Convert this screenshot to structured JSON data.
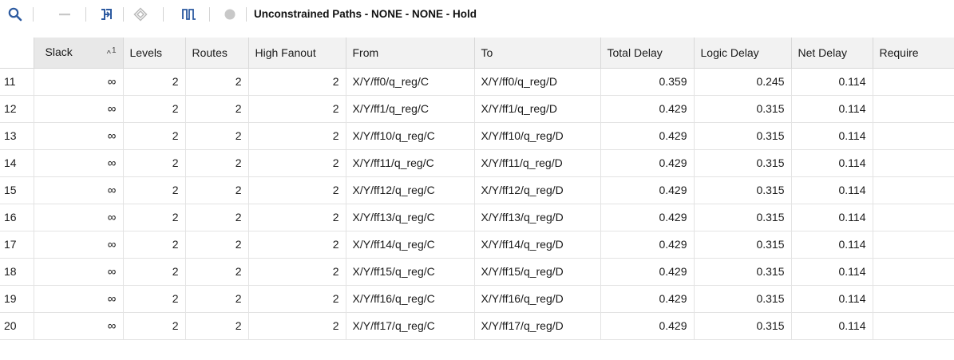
{
  "toolbar": {
    "title": "Unconstrained Paths - NONE - NONE - Hold",
    "buttons": [
      {
        "name": "search-icon"
      },
      {
        "name": "collapse-icon"
      },
      {
        "name": "schematic-icon"
      },
      {
        "name": "highlight-icon"
      },
      {
        "name": "waveform-icon"
      },
      {
        "name": "circle-icon"
      }
    ],
    "colors": {
      "accent": "#2c5aa0",
      "disabled": "#c8c8c8"
    }
  },
  "table": {
    "sort": {
      "column": "Slack",
      "order": "^",
      "rank": "1"
    },
    "columns": [
      "Slack",
      "Levels",
      "Routes",
      "High Fanout",
      "From",
      "To",
      "Total Delay",
      "Logic Delay",
      "Net Delay",
      "Require"
    ],
    "rows": [
      {
        "id": "11",
        "slack": "∞",
        "levels": "2",
        "routes": "2",
        "fanout": "2",
        "from": "X/Y/ff0/q_reg/C",
        "to": "X/Y/ff0/q_reg/D",
        "total": "0.359",
        "logic": "0.245",
        "net": "0.114"
      },
      {
        "id": "12",
        "slack": "∞",
        "levels": "2",
        "routes": "2",
        "fanout": "2",
        "from": "X/Y/ff1/q_reg/C",
        "to": "X/Y/ff1/q_reg/D",
        "total": "0.429",
        "logic": "0.315",
        "net": "0.114"
      },
      {
        "id": "13",
        "slack": "∞",
        "levels": "2",
        "routes": "2",
        "fanout": "2",
        "from": "X/Y/ff10/q_reg/C",
        "to": "X/Y/ff10/q_reg/D",
        "total": "0.429",
        "logic": "0.315",
        "net": "0.114"
      },
      {
        "id": "14",
        "slack": "∞",
        "levels": "2",
        "routes": "2",
        "fanout": "2",
        "from": "X/Y/ff11/q_reg/C",
        "to": "X/Y/ff11/q_reg/D",
        "total": "0.429",
        "logic": "0.315",
        "net": "0.114"
      },
      {
        "id": "15",
        "slack": "∞",
        "levels": "2",
        "routes": "2",
        "fanout": "2",
        "from": "X/Y/ff12/q_reg/C",
        "to": "X/Y/ff12/q_reg/D",
        "total": "0.429",
        "logic": "0.315",
        "net": "0.114"
      },
      {
        "id": "16",
        "slack": "∞",
        "levels": "2",
        "routes": "2",
        "fanout": "2",
        "from": "X/Y/ff13/q_reg/C",
        "to": "X/Y/ff13/q_reg/D",
        "total": "0.429",
        "logic": "0.315",
        "net": "0.114"
      },
      {
        "id": "17",
        "slack": "∞",
        "levels": "2",
        "routes": "2",
        "fanout": "2",
        "from": "X/Y/ff14/q_reg/C",
        "to": "X/Y/ff14/q_reg/D",
        "total": "0.429",
        "logic": "0.315",
        "net": "0.114"
      },
      {
        "id": "18",
        "slack": "∞",
        "levels": "2",
        "routes": "2",
        "fanout": "2",
        "from": "X/Y/ff15/q_reg/C",
        "to": "X/Y/ff15/q_reg/D",
        "total": "0.429",
        "logic": "0.315",
        "net": "0.114"
      },
      {
        "id": "19",
        "slack": "∞",
        "levels": "2",
        "routes": "2",
        "fanout": "2",
        "from": "X/Y/ff16/q_reg/C",
        "to": "X/Y/ff16/q_reg/D",
        "total": "0.429",
        "logic": "0.315",
        "net": "0.114"
      },
      {
        "id": "20",
        "slack": "∞",
        "levels": "2",
        "routes": "2",
        "fanout": "2",
        "from": "X/Y/ff17/q_reg/C",
        "to": "X/Y/ff17/q_reg/D",
        "total": "0.429",
        "logic": "0.315",
        "net": "0.114"
      }
    ]
  }
}
